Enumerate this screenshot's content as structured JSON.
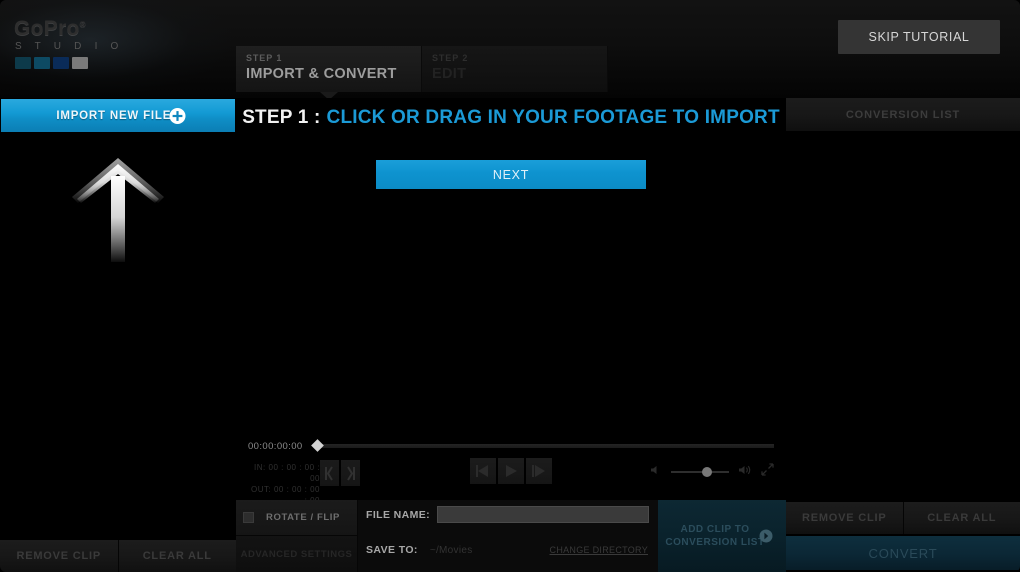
{
  "app": {
    "logo_primary": "GoPro",
    "logo_trademark": "®",
    "logo_secondary": "S T U D I O",
    "swatch_colors": [
      "#0d3a4a",
      "#0d4a63",
      "#0a2b58",
      "#7a7a7a"
    ]
  },
  "header": {
    "skip_tutorial_label": "SKIP TUTORIAL",
    "steps": [
      {
        "num": "STEP 1",
        "name": "IMPORT & CONVERT",
        "active": true
      },
      {
        "num": "STEP 2",
        "name": "EDIT",
        "active": false
      }
    ]
  },
  "left_panel": {
    "import_label": "IMPORT NEW FILES",
    "plus_icon": "plus-circle-icon",
    "arrow_icon": "upload-arrow-icon",
    "remove_clip_label": "REMOVE CLIP",
    "clear_all_label": "CLEAR ALL"
  },
  "center": {
    "tutorial_step_label": "STEP 1 :",
    "tutorial_message": "CLICK OR DRAG IN YOUR FOOTAGE TO IMPORT",
    "next_label": "NEXT",
    "accent_color": "#1b9ad6"
  },
  "player": {
    "timecode": "00:00:00:00",
    "in_label": "IN:",
    "in_value": "00 : 00 : 00 : 00",
    "out_label": "OUT:",
    "out_value": "00 : 00 : 00 : 00",
    "mark_in_icon": "mark-in-bracket-icon",
    "mark_out_icon": "mark-out-bracket-icon",
    "prev_frame_icon": "step-back-icon",
    "play_icon": "play-icon",
    "next_frame_icon": "step-forward-icon",
    "volume_low_icon": "volume-low-icon",
    "volume_high_icon": "volume-high-icon",
    "fullscreen_icon": "fullscreen-icon",
    "volume_percent": 60
  },
  "settings": {
    "rotate_flip_label": "ROTATE / FLIP",
    "rotate_flip_checked": false,
    "advanced_settings_label": "ADVANCED SETTINGS",
    "file_name_label": "FILE NAME:",
    "file_name_value": "",
    "file_name_placeholder": "",
    "save_to_label": "SAVE TO:",
    "save_to_value": "~/Movies",
    "change_directory_label": "CHANGE DIRECTORY",
    "add_clip_line1": "ADD CLIP TO",
    "add_clip_line2": "CONVERSION LIST",
    "add_clip_arrow_icon": "arrow-right-circle-icon"
  },
  "right_panel": {
    "conversion_list_title": "CONVERSION LIST",
    "remove_clip_label": "REMOVE CLIP",
    "clear_all_label": "CLEAR ALL",
    "convert_label": "CONVERT"
  }
}
